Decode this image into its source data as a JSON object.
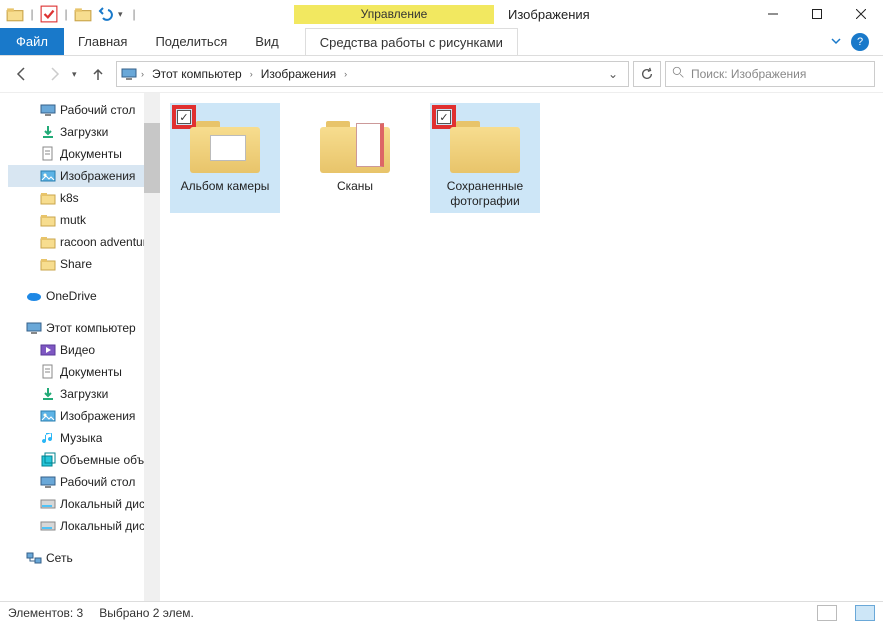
{
  "title": "Изображения",
  "context_tab": {
    "top": "Управление",
    "bottom": "Средства работы с рисунками"
  },
  "ribbon": {
    "file": "Файл",
    "home": "Главная",
    "share": "Поделиться",
    "view": "Вид"
  },
  "breadcrumb": {
    "root": "Этот компьютер",
    "leaf": "Изображения"
  },
  "search": {
    "placeholder": "Поиск: Изображения"
  },
  "sidebar": {
    "quick": [
      {
        "label": "Рабочий стол",
        "pinned": true,
        "icon": "desktop"
      },
      {
        "label": "Загрузки",
        "pinned": true,
        "icon": "downloads"
      },
      {
        "label": "Документы",
        "pinned": true,
        "icon": "documents"
      },
      {
        "label": "Изображения",
        "pinned": true,
        "icon": "pictures",
        "selected": true
      },
      {
        "label": "k8s",
        "pinned": false,
        "icon": "folder"
      },
      {
        "label": "mutk",
        "pinned": false,
        "icon": "folder"
      },
      {
        "label": "racoon adventure",
        "pinned": false,
        "icon": "folder"
      },
      {
        "label": "Share",
        "pinned": false,
        "icon": "folder"
      }
    ],
    "onedrive": "OneDrive",
    "thispc": {
      "label": "Этот компьютер",
      "children": [
        {
          "label": "Видео",
          "icon": "videos"
        },
        {
          "label": "Документы",
          "icon": "documents"
        },
        {
          "label": "Загрузки",
          "icon": "downloads"
        },
        {
          "label": "Изображения",
          "icon": "pictures"
        },
        {
          "label": "Музыка",
          "icon": "music"
        },
        {
          "label": "Объемные объе",
          "icon": "3d"
        },
        {
          "label": "Рабочий стол",
          "icon": "desktop"
        },
        {
          "label": "Локальный диск",
          "icon": "disk"
        },
        {
          "label": "Локальный диск",
          "icon": "disk"
        }
      ]
    },
    "network": "Сеть"
  },
  "items": [
    {
      "label": "Альбом камеры",
      "selected": true,
      "highlighted": true,
      "kind": "album"
    },
    {
      "label": "Сканы",
      "selected": false,
      "highlighted": false,
      "kind": "scan"
    },
    {
      "label": "Сохраненные фотографии",
      "selected": true,
      "highlighted": true,
      "kind": "plain"
    }
  ],
  "status": {
    "count_label": "Элементов: 3",
    "sel_label": "Выбрано 2 элем."
  }
}
